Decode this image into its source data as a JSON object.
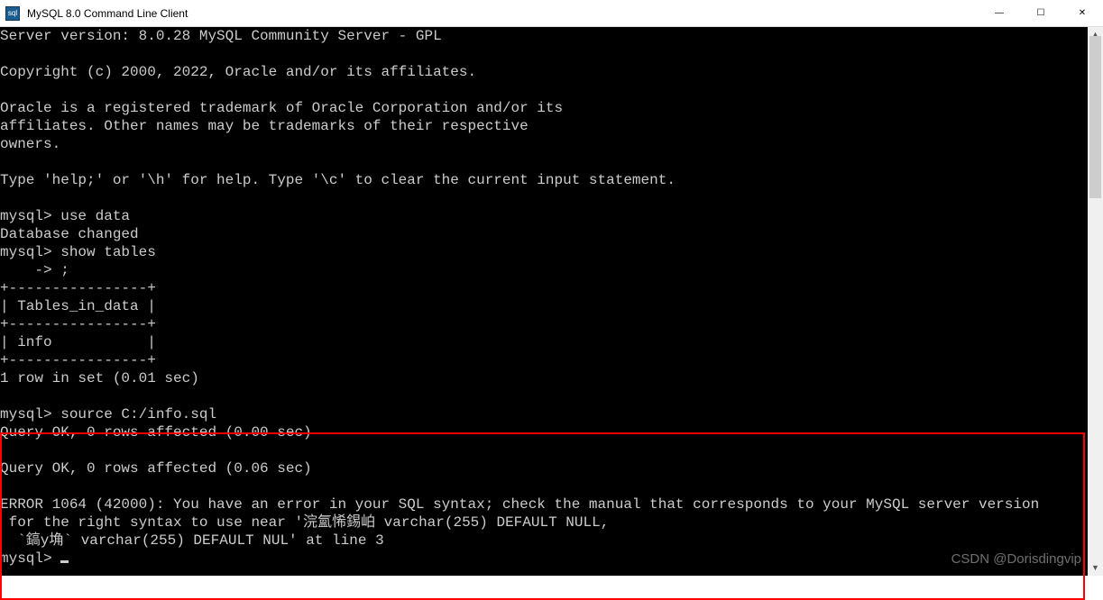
{
  "window": {
    "title": "MySQL 8.0 Command Line Client",
    "icon_label": "mysql-app-icon"
  },
  "controls": {
    "minimize": "—",
    "maximize": "☐",
    "close": "✕"
  },
  "terminal": {
    "lines": [
      "Server version: 8.0.28 MySQL Community Server - GPL",
      "",
      "Copyright (c) 2000, 2022, Oracle and/or its affiliates.",
      "",
      "Oracle is a registered trademark of Oracle Corporation and/or its",
      "affiliates. Other names may be trademarks of their respective",
      "owners.",
      "",
      "Type 'help;' or '\\h' for help. Type '\\c' to clear the current input statement.",
      "",
      "mysql> use data",
      "Database changed",
      "mysql> show tables",
      "    -> ;",
      "+----------------+",
      "| Tables_in_data |",
      "+----------------+",
      "| info           |",
      "+----------------+",
      "1 row in set (0.01 sec)",
      "",
      "mysql> source C:/info.sql",
      "Query OK, 0 rows affected (0.00 sec)",
      "",
      "Query OK, 0 rows affected (0.06 sec)",
      "",
      "ERROR 1064 (42000): You have an error in your SQL syntax; check the manual that corresponds to your MySQL server version",
      " for the right syntax to use near '浣氳悕錫岶 varchar(255) DEFAULT NULL,",
      "  `鎬у埆` varchar(255) DEFAULT NUL' at line 3",
      "mysql> "
    ],
    "prompt_cursor": true
  },
  "watermark": "CSDN @Dorisdingvip"
}
